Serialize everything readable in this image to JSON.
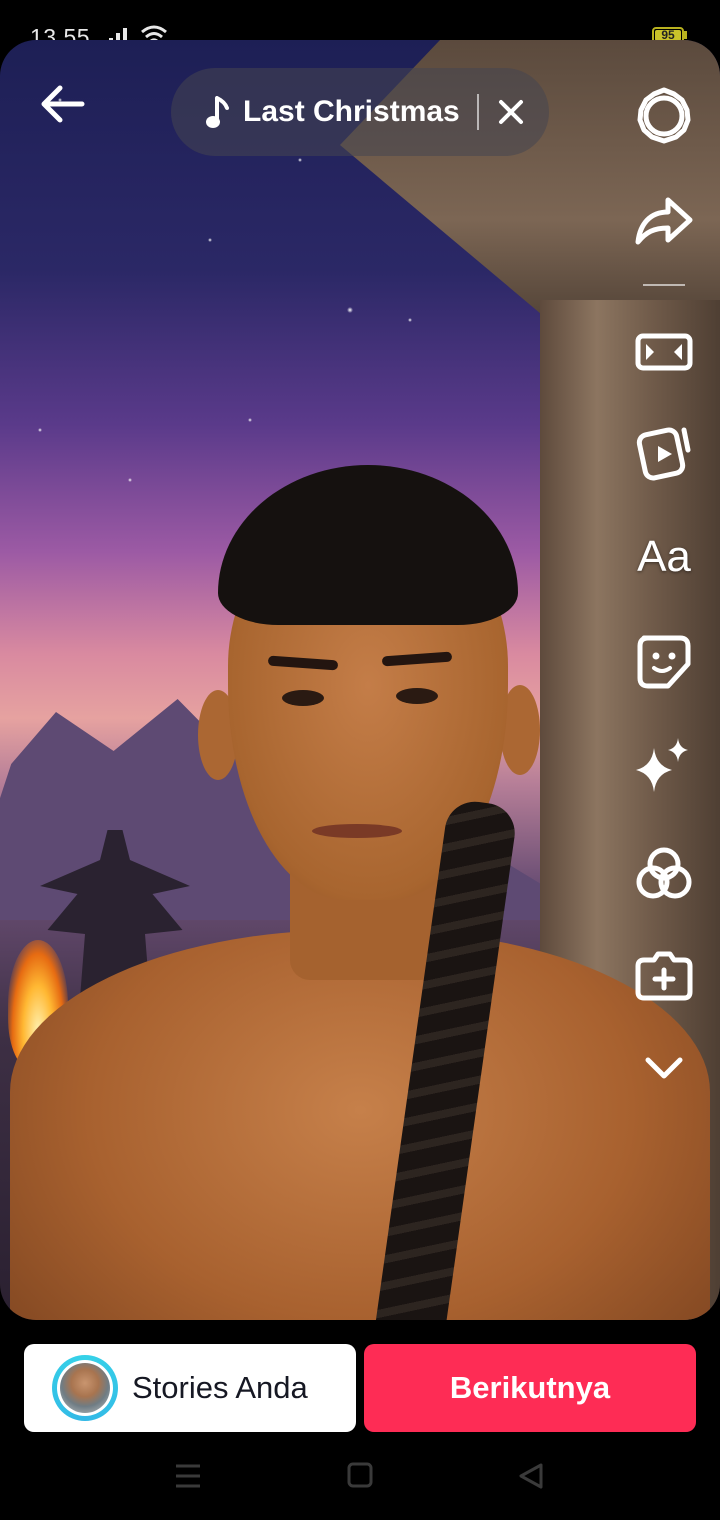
{
  "status_bar": {
    "time": "13.55",
    "battery": "95"
  },
  "music": {
    "title": "Last Christmas"
  },
  "tools": {
    "text_label": "Aa"
  },
  "bottom": {
    "stories_label": "Stories Anda",
    "next_label": "Berikutnya"
  },
  "colors": {
    "accent": "#fe2c55",
    "avatar_ring": "#36d2e8"
  },
  "icons": [
    "back-arrow-icon",
    "music-note-icon",
    "close-icon",
    "settings-icon",
    "share-icon",
    "resize-icon",
    "template-icon",
    "text-icon",
    "sticker-icon",
    "effects-icon",
    "filters-icon",
    "add-clip-icon",
    "chevron-down-icon"
  ]
}
